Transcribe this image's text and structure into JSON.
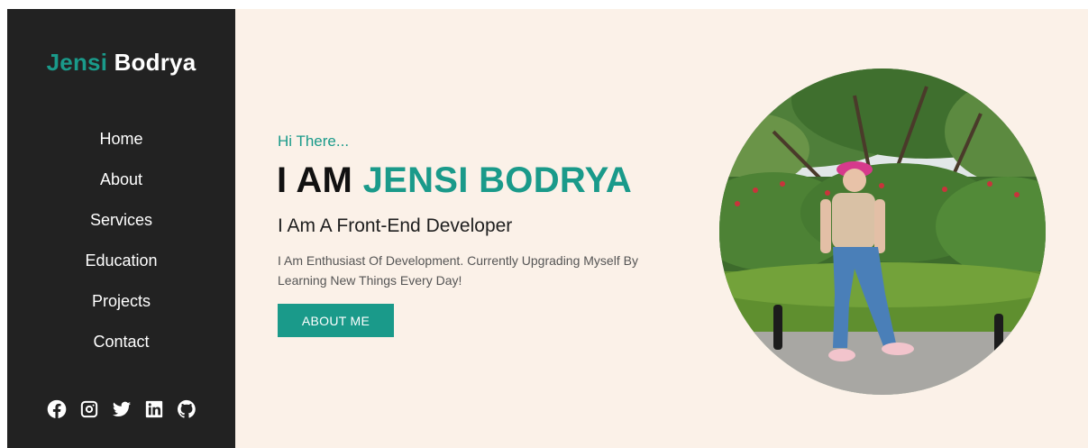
{
  "brand": {
    "first": "Jensi",
    "last": "Bodrya"
  },
  "nav": [
    {
      "label": "Home"
    },
    {
      "label": "About"
    },
    {
      "label": "Services"
    },
    {
      "label": "Education"
    },
    {
      "label": "Projects"
    },
    {
      "label": "Contact"
    }
  ],
  "social": [
    "facebook-icon",
    "instagram-icon",
    "twitter-icon",
    "linkedin-icon",
    "github-icon"
  ],
  "hero": {
    "greeting": "Hi There...",
    "headline_prefix": "I AM",
    "headline_name": "JENSI BODRYA",
    "role": "I Am A Front-End Developer",
    "description": "I Am Enthusiast Of Development. Currently Upgrading Myself By Learning New Things Every Day!",
    "button_label": "ABOUT ME"
  },
  "colors": {
    "accent": "#1a9a8a",
    "sidebar": "#222222",
    "background": "#fbf1e8"
  }
}
